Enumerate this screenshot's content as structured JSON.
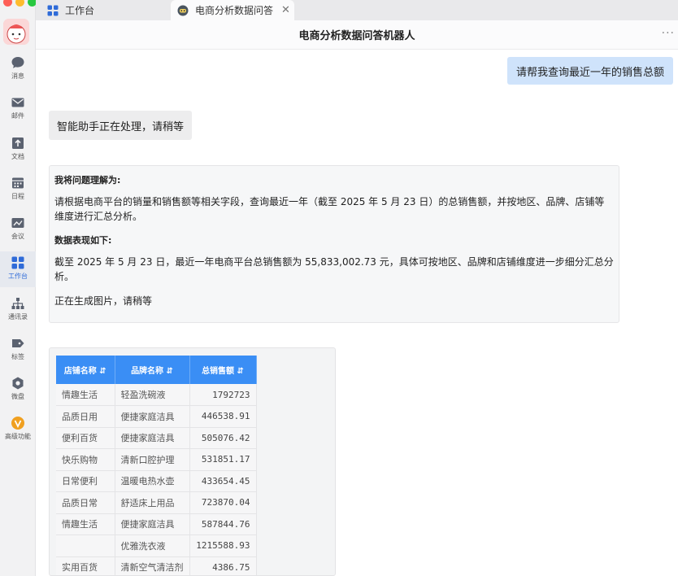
{
  "window": {
    "tabs": [
      {
        "label": "工作台",
        "icon": "grid-icon"
      },
      {
        "label": "电商分析数据问答",
        "icon": "bot-icon",
        "close": "✕"
      }
    ],
    "title": "电商分析数据问答机器人",
    "more": "···"
  },
  "sidebar": {
    "items": [
      {
        "label": "消息",
        "icon": "chat-bubble-icon"
      },
      {
        "label": "邮件",
        "icon": "mail-icon"
      },
      {
        "label": "文档",
        "icon": "doc-icon"
      },
      {
        "label": "日程",
        "icon": "calendar-icon"
      },
      {
        "label": "会议",
        "icon": "meeting-icon"
      },
      {
        "label": "工作台",
        "icon": "grid-icon"
      },
      {
        "label": "通讯录",
        "icon": "org-chart-icon"
      },
      {
        "label": "标签",
        "icon": "tag-icon"
      },
      {
        "label": "微盘",
        "icon": "cloud-drive-icon"
      },
      {
        "label": "高级功能",
        "icon": "premium-icon"
      }
    ],
    "active": "工作台"
  },
  "chat": {
    "user_message": "请帮我查询最近一年的销售总额",
    "status_message": "智能助手正在处理，请稍等",
    "answer": {
      "understanding_heading": "我将问题理解为:",
      "understanding_text": "请根据电商平台的销量和销售额等相关字段，查询最近一年（截至 2025 年 5 月 23 日）的总销售额，并按地区、品牌、店铺等维度进行汇总分析。",
      "data_heading": "数据表现如下:",
      "data_text": "截至 2025 年 5 月 23 日，最近一年电商平台总销售额为 55,833,002.73 元，具体可按地区、品牌和店铺维度进一步细分汇总分析。",
      "generating": "正在生成图片，请稍等"
    },
    "table": {
      "headers": [
        "店铺名称 ⇵",
        "品牌名称 ⇵",
        "总销售额 ⇵"
      ],
      "rows": [
        [
          "情趣生活",
          "轻盈洗碗液",
          "1792723"
        ],
        [
          "品质日用",
          "便捷家庭洁具",
          "446538.91"
        ],
        [
          "便利百货",
          "便捷家庭洁具",
          "505076.42"
        ],
        [
          "快乐购物",
          "清新口腔护理",
          "531851.17"
        ],
        [
          "日常便利",
          "温暖电热水壶",
          "433654.45"
        ],
        [
          "品质日常",
          "舒适床上用品",
          "723870.04"
        ],
        [
          "情趣生活",
          "便捷家庭洁具",
          "587844.76"
        ],
        [
          "",
          "优雅洗衣液",
          "1215588.93"
        ],
        [
          "实用百货",
          "清新空气清洁剂",
          "4386.75"
        ]
      ]
    }
  },
  "colors": {
    "accent": "#3a8ef5",
    "user_bubble": "#cfe3fb",
    "active_nav": "#2f6bd8"
  }
}
